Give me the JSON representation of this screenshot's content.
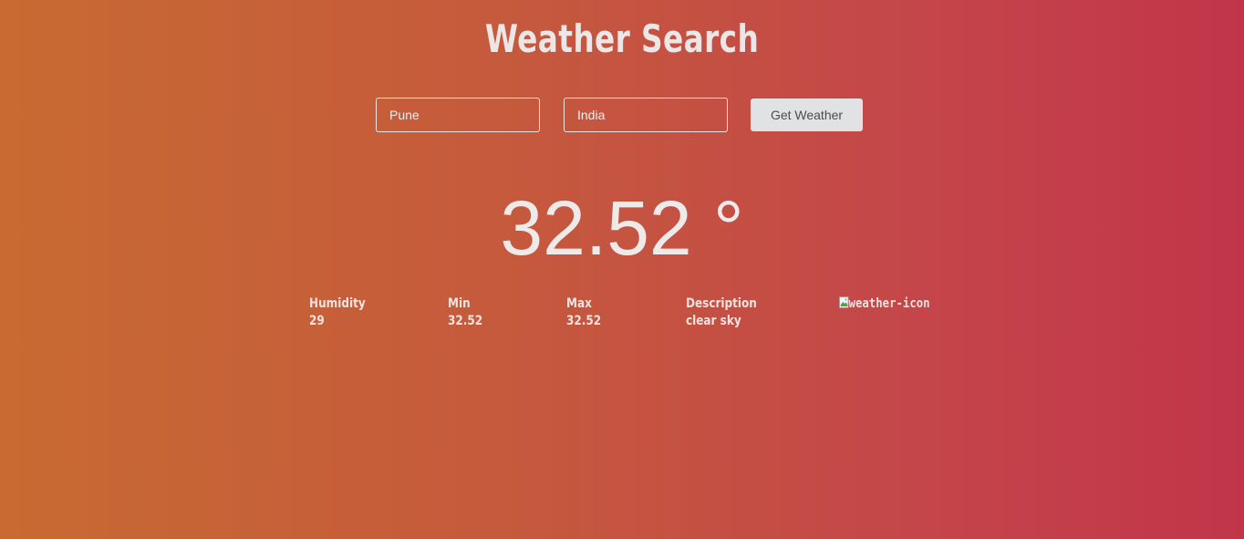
{
  "header": {
    "title": "Weather Search"
  },
  "search": {
    "city_value": "Pune",
    "country_value": "India",
    "button_label": "Get Weather"
  },
  "weather": {
    "temperature": "32.52 °",
    "humidity": {
      "label": "Humidity",
      "value": "29"
    },
    "min": {
      "label": "Min",
      "value": "32.52"
    },
    "max": {
      "label": "Max",
      "value": "32.52"
    },
    "description": {
      "label": "Description",
      "value": "clear sky"
    },
    "icon_alt": "weather-icon"
  },
  "colors": {
    "gradient_start": "#c86a32",
    "gradient_end": "#c23549",
    "button_bg": "#e1e2e4"
  },
  "icons": {
    "weather_icon": "broken-image-icon"
  }
}
